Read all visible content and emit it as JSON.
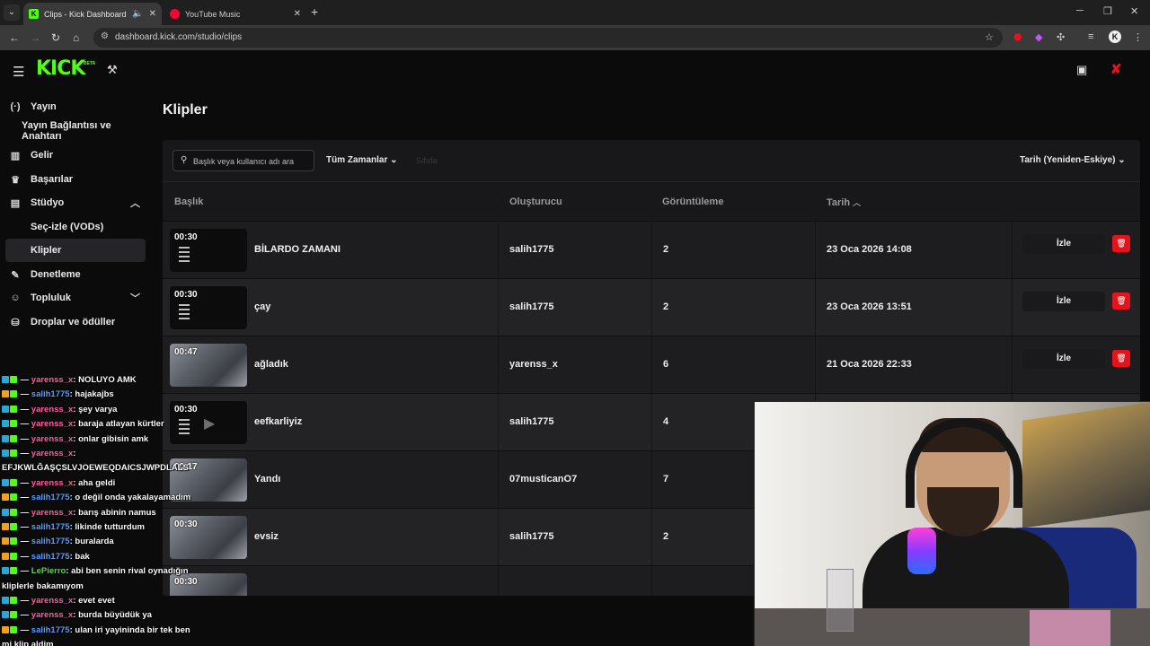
{
  "browser": {
    "tabs": [
      {
        "title": "Clips - Kick Dashboard",
        "active": true
      },
      {
        "title": "YouTube Music",
        "active": false
      }
    ],
    "url": "dashboard.kick.com/studio/clips"
  },
  "header": {
    "logo": "KICK",
    "badge": "BETA"
  },
  "sidebar": {
    "items": [
      {
        "label": "Yayın",
        "icon": "broadcast-icon"
      },
      {
        "label": "Yayın Bağlantısı ve Anahtarı",
        "icon": ""
      },
      {
        "label": "Gelir",
        "icon": "chart-icon"
      },
      {
        "label": "Başarılar",
        "icon": "trophy-icon"
      },
      {
        "label": "Stüdyo",
        "icon": "studio-icon",
        "expanded": true
      },
      {
        "label": "Seç-izle (VODs)",
        "icon": ""
      },
      {
        "label": "Klipler",
        "icon": "",
        "active": true
      },
      {
        "label": "Denetleme",
        "icon": "wrench-icon"
      },
      {
        "label": "Topluluk",
        "icon": "people-icon",
        "expanded": false
      },
      {
        "label": "Droplar ve ödüller",
        "icon": "gift-icon"
      }
    ]
  },
  "main": {
    "title": "Klipler",
    "search_placeholder": "Başlık veya kullanıcı adı ara",
    "filter_time": "Tüm Zamanlar",
    "filter_reset": "Sıfırla",
    "sort": "Tarih (Yeniden-Eskiye)",
    "columns": {
      "title": "Başlık",
      "creator": "Oluşturucu",
      "views": "Görüntüleme",
      "date": "Tarih"
    },
    "watch_label": "İzle",
    "rows": [
      {
        "duration": "00:30",
        "title": "BİLARDO ZAMANI",
        "creator": "salih1775",
        "views": "2",
        "date": "23 Oca 2026 14:08",
        "thumb": "dark"
      },
      {
        "duration": "00:30",
        "title": "çay",
        "creator": "salih1775",
        "views": "2",
        "date": "23 Oca 2026 13:51",
        "thumb": "dark"
      },
      {
        "duration": "00:47",
        "title": "ağladık",
        "creator": "yarenss_x",
        "views": "6",
        "date": "21 Oca 2026 22:33",
        "thumb": "cam"
      },
      {
        "duration": "00:30",
        "title": "eefkarliyiz",
        "creator": "salih1775",
        "views": "4",
        "date": "",
        "thumb": "dark"
      },
      {
        "duration": "00:17",
        "title": "Yandı",
        "creator": "07musticanO7",
        "views": "7",
        "date": "",
        "thumb": "cam"
      },
      {
        "duration": "00:30",
        "title": "evsiz",
        "creator": "salih1775",
        "views": "2",
        "date": "",
        "thumb": "cam"
      },
      {
        "duration": "00:30",
        "title": "",
        "creator": "",
        "views": "",
        "date": "",
        "thumb": "cam"
      }
    ]
  },
  "chat": [
    {
      "nick": "yarenss_x",
      "text": "NOLUYO AMK"
    },
    {
      "nick": "salih1775",
      "text": "hajakajbs"
    },
    {
      "nick": "yarenss_x",
      "text": "şey varya"
    },
    {
      "nick": "yarenss_x",
      "text": "baraja atlayan kürtler"
    },
    {
      "nick": "yarenss_x",
      "text": "onlar gibisin amk"
    },
    {
      "nick": "yarenss_x",
      "text": ""
    },
    {
      "nick": "",
      "text": "EFJKWLĞAŞÇSLVJOEWEQDAICSJWPDLALS"
    },
    {
      "nick": "yarenss_x",
      "text": "aha geldi"
    },
    {
      "nick": "salih1775",
      "text": "o değil onda yakalayamadım"
    },
    {
      "nick": "yarenss_x",
      "text": "barış abinin namus"
    },
    {
      "nick": "salih1775",
      "text": "likinde tutturdum"
    },
    {
      "nick": "salih1775",
      "text": "buralarda"
    },
    {
      "nick": "salih1775",
      "text": "bak"
    },
    {
      "nick": "LePierro",
      "text": "abi ben senin rival oynadığın"
    },
    {
      "nick": "",
      "text": "kliplerle bakamıyom"
    },
    {
      "nick": "yarenss_x",
      "text": "evet evet"
    },
    {
      "nick": "yarenss_x",
      "text": "burda büyüdük ya"
    },
    {
      "nick": "salih1775",
      "text": "ulan iri yayininda bir tek ben"
    },
    {
      "nick": "",
      "text": "mi klip aldim"
    }
  ],
  "colors": {
    "brand": "#53fc18",
    "delete": "#e5131b"
  }
}
